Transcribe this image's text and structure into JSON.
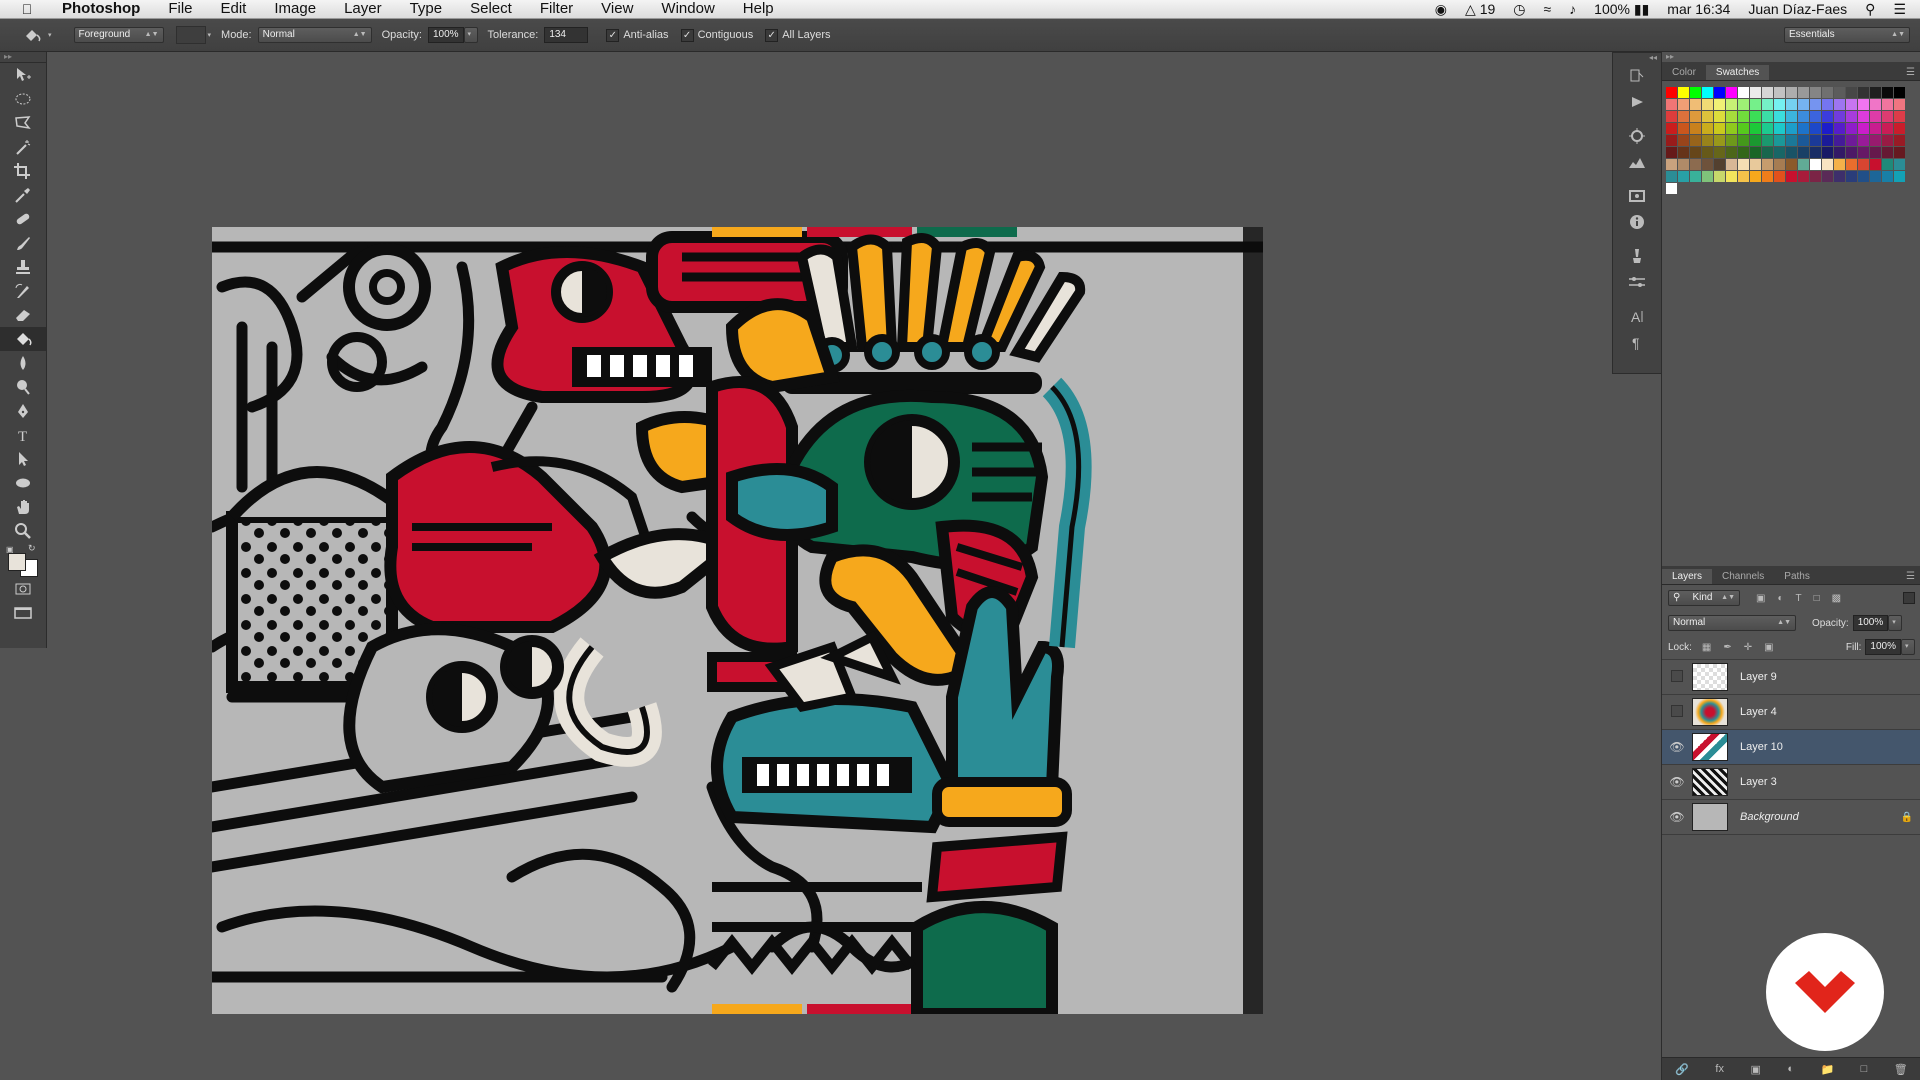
{
  "menubar": {
    "app": "Photoshop",
    "items": [
      "File",
      "Edit",
      "Image",
      "Layer",
      "Type",
      "Select",
      "Filter",
      "View",
      "Window",
      "Help"
    ],
    "status_adobe": "19",
    "status_battery": "100%",
    "status_time": "mar 16:34",
    "status_user": "Juan Díaz-Faes"
  },
  "options": {
    "fill_source": "Foreground",
    "mode_label": "Mode:",
    "mode_value": "Normal",
    "opacity_label": "Opacity:",
    "opacity_value": "100%",
    "tolerance_label": "Tolerance:",
    "tolerance_value": "134",
    "antialias_label": "Anti-alias",
    "contiguous_label": "Contiguous",
    "alllayers_label": "All Layers",
    "workspace": "Essentials"
  },
  "swatch_panel": {
    "tabs": [
      "Color",
      "Swatches"
    ],
    "active_tab": "Swatches"
  },
  "layers_panel": {
    "tabs": [
      "Layers",
      "Channels",
      "Paths"
    ],
    "kind_label": "Kind",
    "blend_mode": "Normal",
    "opacity_label": "Opacity:",
    "opacity_value": "100%",
    "lock_label": "Lock:",
    "fill_label": "Fill:",
    "fill_value": "100%",
    "layers": [
      {
        "name": "Layer 9",
        "visible": false,
        "selected": false
      },
      {
        "name": "Layer 4",
        "visible": false,
        "selected": false
      },
      {
        "name": "Layer 10",
        "visible": true,
        "selected": true
      },
      {
        "name": "Layer 3",
        "visible": true,
        "selected": false
      },
      {
        "name": "Background",
        "visible": true,
        "selected": false,
        "locked": true
      }
    ]
  },
  "colors": {
    "app_bg": "#535353",
    "red": "#c8102e",
    "yellow": "#f6a81c",
    "green": "#0e6b4c",
    "teal": "#2b8d96",
    "cream": "#e8e3da",
    "gray": "#b7b7b7",
    "black": "#0d0d0d",
    "logo_red": "#e1251b"
  }
}
